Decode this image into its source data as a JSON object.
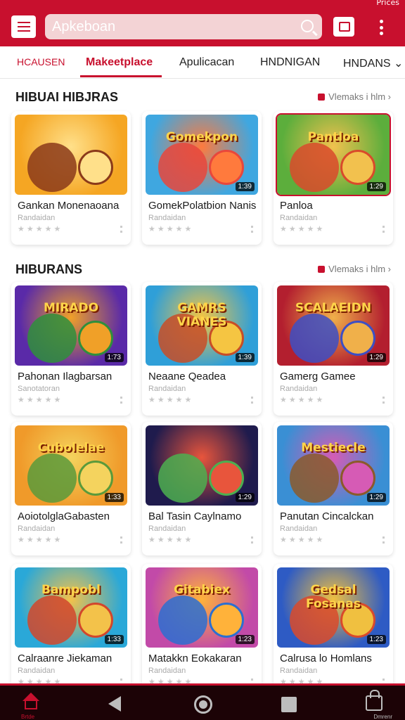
{
  "status_bar": {
    "text": "Prices"
  },
  "header": {
    "search_placeholder": "Apkeboan"
  },
  "tabs": [
    {
      "label": "HCAUSEN"
    },
    {
      "label": "Makeetplace"
    },
    {
      "label": "Apulicacan"
    },
    {
      "label": "HNDNIGAN"
    },
    {
      "label": "HNDANS ⌄"
    }
  ],
  "sections": [
    {
      "title": "HIBUAI HIBJRAS",
      "see_all": "Vlemaks i hlm ›"
    },
    {
      "title": "HIBURANS",
      "see_all": "Vlemaks i hlm ›"
    }
  ],
  "cards": [
    {
      "title": "Gankan Monenaoana",
      "subtitle": "Randaidan",
      "stars": "★★★★★",
      "duration": "",
      "banner": "",
      "bg": "#f5a623",
      "bg2": "#ffe08a",
      "accent": "#8b3a1a"
    },
    {
      "title": "GomekPolatbion Nanis",
      "subtitle": "Randaidan",
      "stars": "★★★★★",
      "duration": "1:39",
      "banner": "Gomekpon",
      "bg": "#3fa7e0",
      "bg2": "#ff7a3d",
      "accent": "#e8473c"
    },
    {
      "title": "Panloa",
      "subtitle": "Randaidan",
      "stars": "★★★★★",
      "duration": "1:29",
      "banner": "Pantloa",
      "bg": "#5cae3c",
      "bg2": "#f2c14e",
      "accent": "#d94a2b"
    },
    {
      "title": "Pahonan Ilagbarsan",
      "subtitle": "Sanotatoran",
      "stars": "★★★★★",
      "duration": "1:73",
      "banner": "MIRADO",
      "bg": "#5a2aa8",
      "bg2": "#f0a028",
      "accent": "#2f8f3c"
    },
    {
      "title": "Neaane Qeadea",
      "subtitle": "Randaidan",
      "stars": "★★★★★",
      "duration": "1:39",
      "banner": "GAMRS VIANES",
      "bg": "#2f9fd8",
      "bg2": "#f5c542",
      "accent": "#c84d27"
    },
    {
      "title": "Gamerg Gamee",
      "subtitle": "Randaidan",
      "stars": "★★★★★",
      "duration": "1:29",
      "banner": "SCALAEIDN",
      "bg": "#b31f2f",
      "bg2": "#f0b04a",
      "accent": "#3d4fc4"
    },
    {
      "title": "AoiotolglaGabasten",
      "subtitle": "Randaidan",
      "stars": "★★★★★",
      "duration": "1:33",
      "banner": "Cubolelae",
      "bg": "#f09a2a",
      "bg2": "#f4d35e",
      "accent": "#5a9a3b"
    },
    {
      "title": "Bal Tasin Caylnamo",
      "subtitle": "Randaidan",
      "stars": "★★★★★",
      "duration": "1:29",
      "banner": "",
      "bg": "#1f1b4d",
      "bg2": "#e8553c",
      "accent": "#4caf50"
    },
    {
      "title": "Panutan Cincalckan",
      "subtitle": "Randaidan",
      "stars": "★★★★★",
      "duration": "1:29",
      "banner": "Mestiecle",
      "bg": "#3a8fd4",
      "bg2": "#d65bb5",
      "accent": "#8b5a2b"
    },
    {
      "title": "Calraanre Jiekaman",
      "subtitle": "Randaidan",
      "stars": "★★★★★",
      "duration": "1:33",
      "banner": "Bampobl",
      "bg": "#2aa8d8",
      "bg2": "#f3c24a",
      "accent": "#d2462c"
    },
    {
      "title": "Matakkn Eokakaran",
      "subtitle": "Randaidan",
      "stars": "★★★★★",
      "duration": "1:23",
      "banner": "Gitabiex",
      "bg": "#c24aa8",
      "bg2": "#ffb23a",
      "accent": "#2b6fd1"
    },
    {
      "title": "Calrusa lo Homlans",
      "subtitle": "Randaidan",
      "stars": "★★★★★",
      "duration": "1:23",
      "banner": "Gedsal Fosanas",
      "bg": "#2e5bc4",
      "bg2": "#f0c040",
      "accent": "#d94a2b"
    }
  ],
  "bottom_nav": {
    "home_label": "Brtde",
    "lock_label": "Dmrenr"
  }
}
